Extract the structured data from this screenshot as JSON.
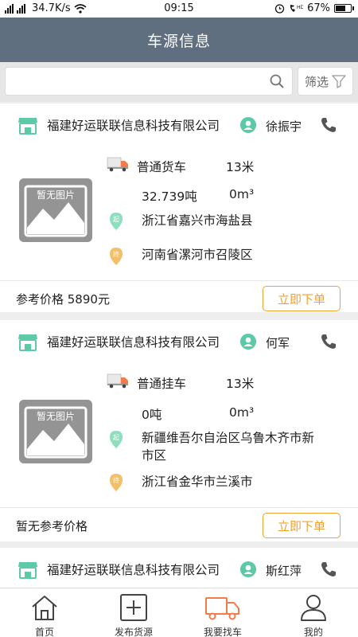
{
  "status_bar": {
    "signal": "5011",
    "speed": "34.7K/s",
    "time": "09:15",
    "network_label": "HD",
    "battery": "67%",
    "battery_level": 0.67
  },
  "header": {
    "title": "车源信息"
  },
  "search": {
    "value": "",
    "placeholder": "",
    "filter_label": "筛选"
  },
  "cards": [
    {
      "company": "福建好运联联信息科技有限公司",
      "contact": "徐振宇",
      "thumb_label": "暂无图片",
      "vehicle_type": "普通货车",
      "length": "13米",
      "weight": "32.739吨",
      "volume": "0m³",
      "from_tag": "起",
      "from": "浙江省嘉兴市海盐县",
      "to_tag": "终",
      "to": "河南省漯河市召陵区",
      "price": "参考价格 5890元",
      "order_label": "立即下单"
    },
    {
      "company": "福建好运联联信息科技有限公司",
      "contact": "何军",
      "thumb_label": "暂无图片",
      "vehicle_type": "普通挂车",
      "length": "13米",
      "weight": "0吨",
      "volume": "0m³",
      "from_tag": "起",
      "from": "新疆维吾尔自治区乌鲁木齐市新市区",
      "to_tag": "终",
      "to": "浙江省金华市兰溪市",
      "price": "暂无参考价格",
      "order_label": "立即下单"
    },
    {
      "company": "福建好运联联信息科技有限公司",
      "contact": "斯红萍"
    }
  ],
  "nav": [
    {
      "label": "首页",
      "icon": "home-icon"
    },
    {
      "label": "发布货源",
      "icon": "plus-square-icon"
    },
    {
      "label": "我要找车",
      "icon": "truck-icon"
    },
    {
      "label": "我的",
      "icon": "person-icon"
    }
  ],
  "colors": {
    "header": "#5f6f7f",
    "accent": "#f0a030",
    "green": "#5cc9a7"
  }
}
